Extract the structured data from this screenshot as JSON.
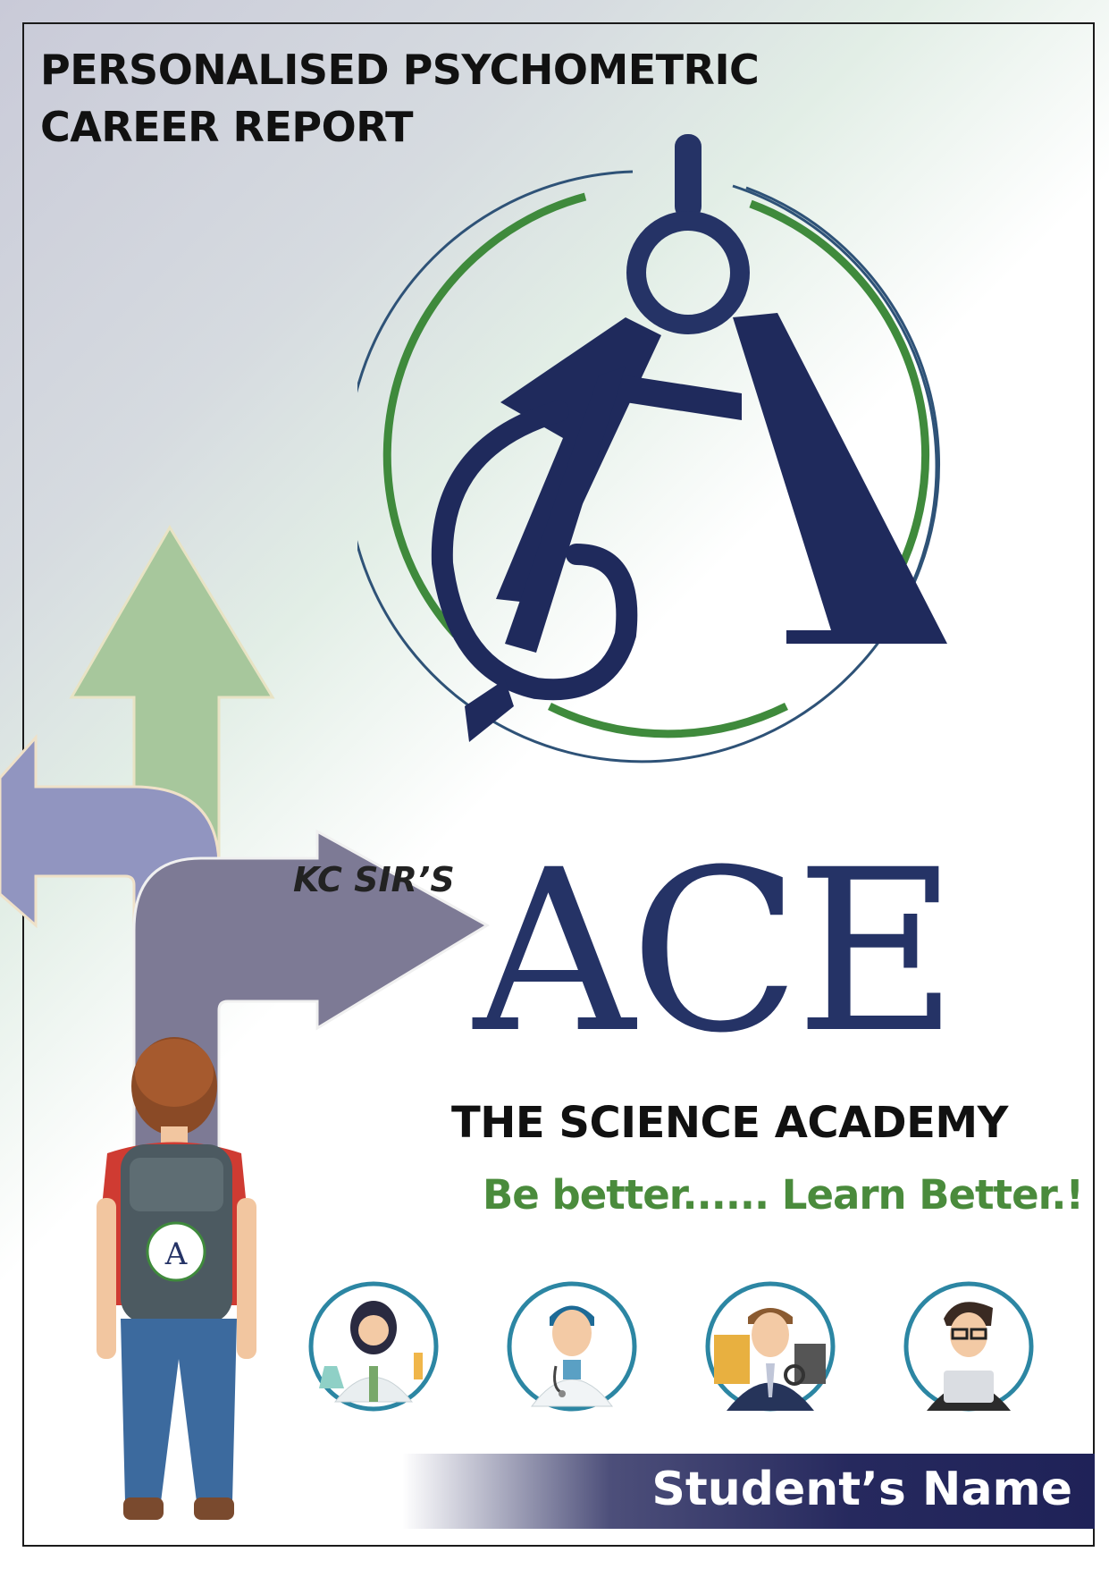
{
  "header": {
    "title_line1": "PERSONALISED PSYCHOMETRIC",
    "title_line2": "CAREER REPORT"
  },
  "brand": {
    "prefix": "KC SIR’S",
    "name": "ACE",
    "academy": "THE SCIENCE ACADEMY",
    "tagline": "Be better...... Learn Better.!",
    "colors": {
      "navy": "#253366",
      "green": "#3f8a3c",
      "tagline": "#4a8b3c"
    }
  },
  "careers": [
    "scientist-icon",
    "doctor-icon",
    "accountant-icon",
    "engineer-icon"
  ],
  "footer": {
    "student_name_label": "Student’s Name"
  }
}
